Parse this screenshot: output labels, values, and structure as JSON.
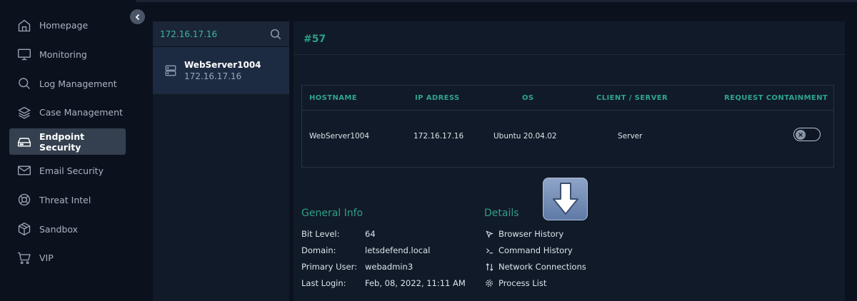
{
  "sidebar": {
    "items": [
      {
        "label": "Homepage",
        "icon": "home-icon",
        "active": false
      },
      {
        "label": "Monitoring",
        "icon": "monitor-icon",
        "active": false
      },
      {
        "label": "Log Management",
        "icon": "search-icon",
        "active": false
      },
      {
        "label": "Case Management",
        "icon": "layers-icon",
        "active": false
      },
      {
        "label": "Endpoint Security",
        "icon": "hard-drive-icon",
        "active": true
      },
      {
        "label": "Email Security",
        "icon": "mail-icon",
        "active": false
      },
      {
        "label": "Threat Intel",
        "icon": "lifebuoy-icon",
        "active": false
      },
      {
        "label": "Sandbox",
        "icon": "box-icon",
        "active": false
      },
      {
        "label": "VIP",
        "icon": "cart-icon",
        "active": false
      }
    ]
  },
  "search": {
    "value": "172.16.17.16",
    "results": [
      {
        "name": "WebServer1004",
        "ip": "172.16.17.16"
      }
    ]
  },
  "main": {
    "case_id": "#57",
    "table": {
      "headers": [
        "HOSTNAME",
        "IP ADRESS",
        "OS",
        "CLIENT / SERVER",
        "REQUEST CONTAINMENT"
      ],
      "row": {
        "hostname": "WebServer1004",
        "ip": "172.16.17.16",
        "os": "Ubuntu 20.04.02",
        "type": "Server",
        "containment_enabled": false
      }
    },
    "general_info": {
      "title": "General Info",
      "rows": [
        {
          "label": "Bit Level:",
          "value": "64"
        },
        {
          "label": "Domain:",
          "value": "letsdefend.local"
        },
        {
          "label": "Primary User:",
          "value": "webadmin3"
        },
        {
          "label": "Last Login:",
          "value": "Feb, 08, 2022, 11:11 AM"
        }
      ]
    },
    "details": {
      "title": "Details",
      "links": [
        {
          "label": "Browser History",
          "icon": "cursor-icon"
        },
        {
          "label": "Command History",
          "icon": "terminal-icon"
        },
        {
          "label": "Network Connections",
          "icon": "network-icon"
        },
        {
          "label": "Process List",
          "icon": "gear-icon"
        }
      ]
    }
  },
  "colors": {
    "accent": "#2e9f88",
    "background": "#0c111e",
    "panel": "#111a28",
    "active_nav": "#34404f"
  }
}
